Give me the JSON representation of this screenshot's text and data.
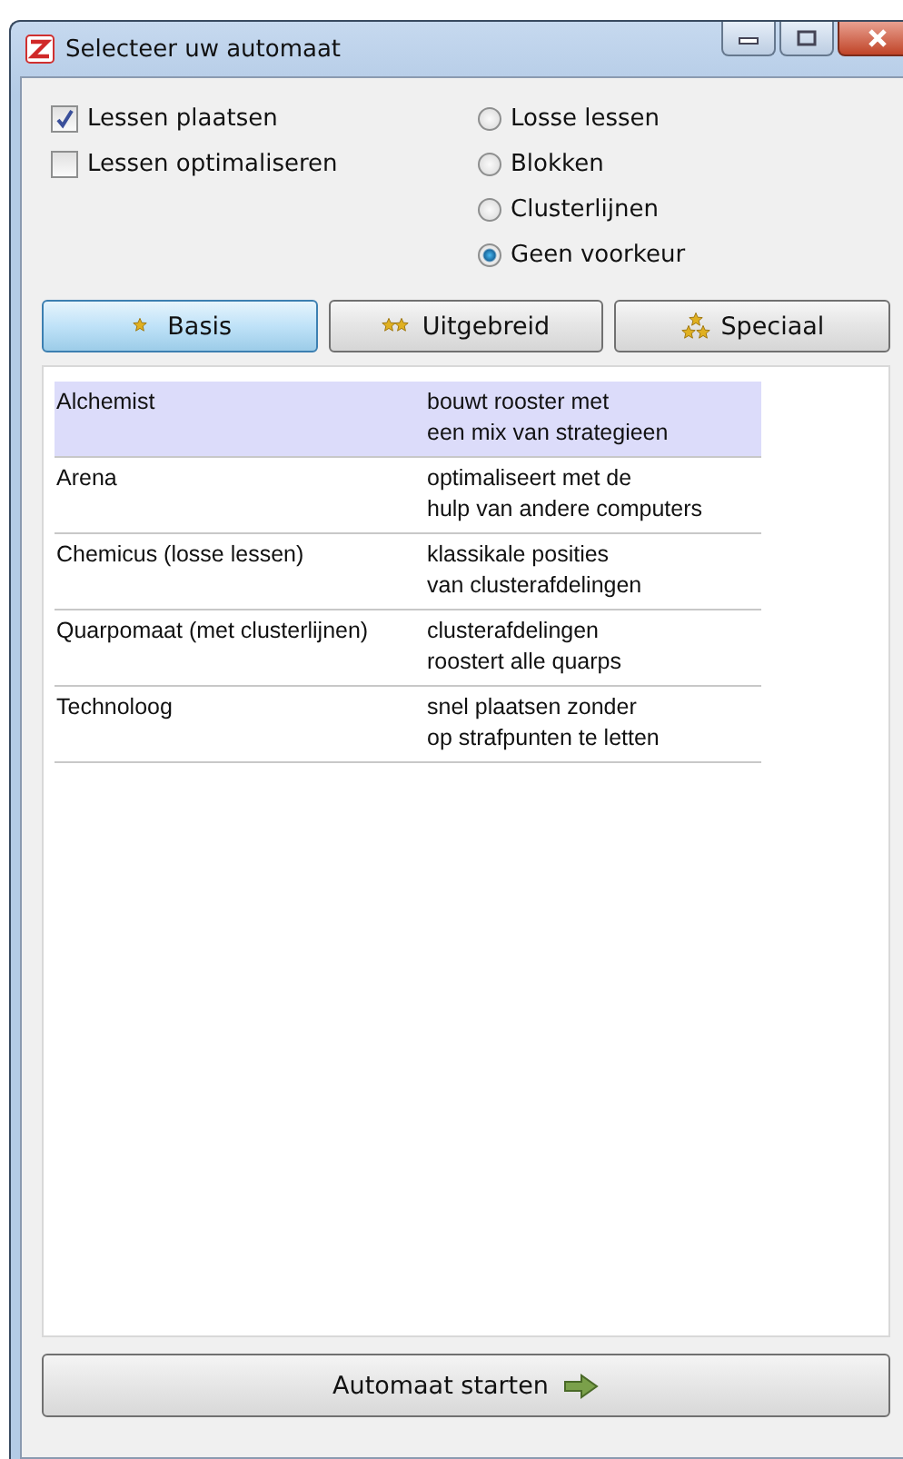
{
  "window": {
    "title": "Selecteer uw automaat"
  },
  "checkboxes": [
    {
      "label": "Lessen plaatsen",
      "checked": true
    },
    {
      "label": "Lessen optimaliseren",
      "checked": false
    }
  ],
  "radios": [
    {
      "label": "Losse lessen",
      "selected": false
    },
    {
      "label": "Blokken",
      "selected": false
    },
    {
      "label": "Clusterlijnen",
      "selected": false
    },
    {
      "label": "Geen voorkeur",
      "selected": true
    }
  ],
  "tabs": [
    {
      "label": "Basis",
      "selected": true
    },
    {
      "label": "Uitgebreid",
      "selected": false
    },
    {
      "label": "Speciaal",
      "selected": false
    }
  ],
  "rows": [
    {
      "name": "Alchemist",
      "description": [
        "bouwt rooster met",
        "een mix van strategieen"
      ],
      "selected": true
    },
    {
      "name": "Arena",
      "description": [
        "optimaliseert met de",
        "hulp van andere computers"
      ],
      "selected": false
    },
    {
      "name": "Chemicus (losse lessen)",
      "description": [
        "klassikale posities",
        "van clusterafdelingen"
      ],
      "selected": false
    },
    {
      "name": "Quarpomaat (met clusterlijnen)",
      "description": [
        "clusterafdelingen",
        "roostert alle quarps"
      ],
      "selected": false
    },
    {
      "name": "Technoloog",
      "description": [
        "snel plaatsen zonder",
        "op strafpunten te letten"
      ],
      "selected": false
    }
  ],
  "start_button": "Automaat starten"
}
